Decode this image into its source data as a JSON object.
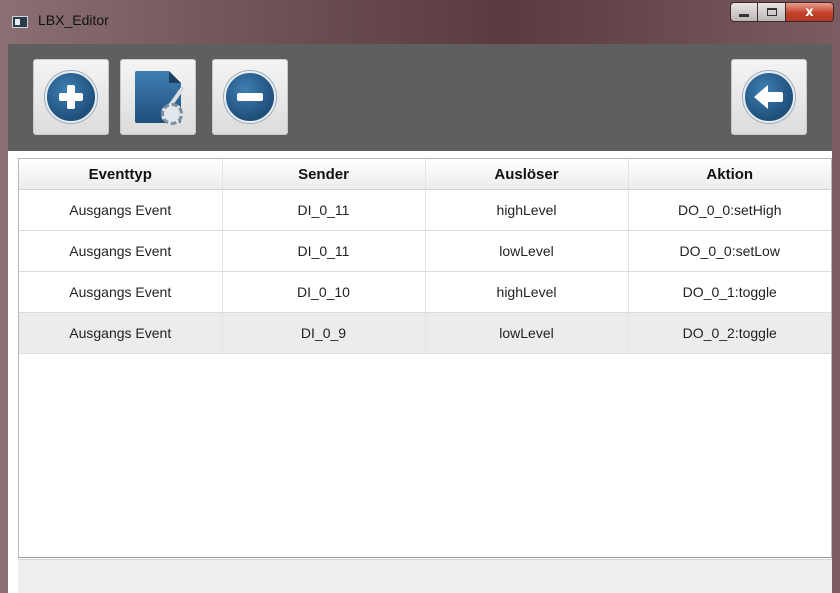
{
  "window": {
    "title": "LBX_Editor",
    "caption_buttons": [
      "minimize",
      "maximize",
      "close"
    ],
    "close_glyph": "x"
  },
  "toolbar": {
    "buttons": [
      {
        "icon": "add-circle-icon"
      },
      {
        "icon": "edit-document-settings-icon"
      },
      {
        "icon": "remove-circle-icon"
      },
      {
        "icon": "back-arrow-icon"
      }
    ]
  },
  "table": {
    "columns": [
      "Eventtyp",
      "Sender",
      "Auslöser",
      "Aktion"
    ],
    "rows": [
      [
        "Ausgangs Event",
        "DI_0_11",
        "highLevel",
        "DO_0_0:setHigh"
      ],
      [
        "Ausgangs Event",
        "DI_0_11",
        "lowLevel",
        "DO_0_0:setLow"
      ],
      [
        "Ausgangs Event",
        "DI_0_10",
        "highLevel",
        "DO_0_1:toggle"
      ],
      [
        "Ausgangs Event",
        "DI_0_9",
        "lowLevel",
        "DO_0_2:toggle"
      ]
    ],
    "selected_row": 3
  },
  "colors": {
    "toolbar_bg": "#5f5f5f",
    "icon_blue": "#1f4f7a",
    "selected_row": "#ececec"
  }
}
